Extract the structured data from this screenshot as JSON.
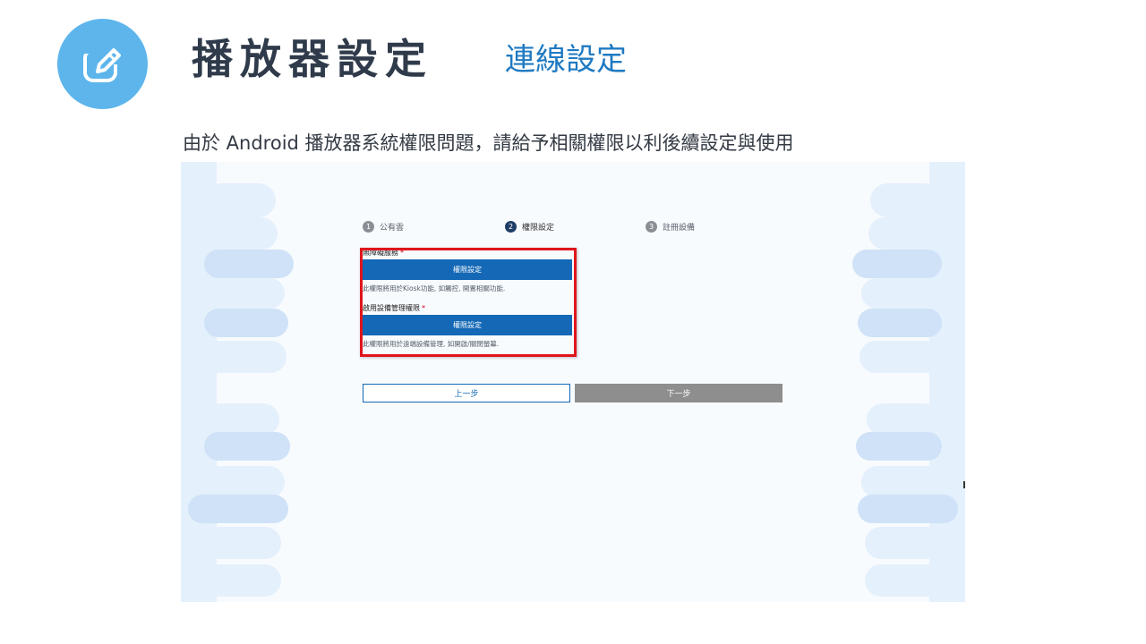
{
  "header": {
    "icon": "edit-icon",
    "title": "播放器設定",
    "subtitle": "連線設定",
    "badge_color": "#5db5ec"
  },
  "description": "由於 Android 播放器系統權限問題，請給予相關權限以利後續設定與使用",
  "screenshot": {
    "steps": [
      {
        "num": "1",
        "label": "公有雲",
        "state": "done"
      },
      {
        "num": "2",
        "label": "權限設定",
        "state": "active"
      },
      {
        "num": "3",
        "label": "註冊設備",
        "state": "pending"
      }
    ],
    "permissions": [
      {
        "label": "無障礙服務",
        "required_mark": "*",
        "button_label": "權限設定",
        "hint": "此權限將用於Kiosk功能, 如觸控, 開置相關功能."
      },
      {
        "label": "啟用設備管理權限",
        "required_mark": "*",
        "button_label": "權限設定",
        "hint": "此權限將用於遠端設備管理, 如開啟/關閉螢幕."
      }
    ],
    "prev_label": "上一步",
    "next_label": "下一步",
    "colors": {
      "primary": "#1468b6",
      "highlight": "#e0161b",
      "disabled": "#8e8e8e"
    }
  }
}
